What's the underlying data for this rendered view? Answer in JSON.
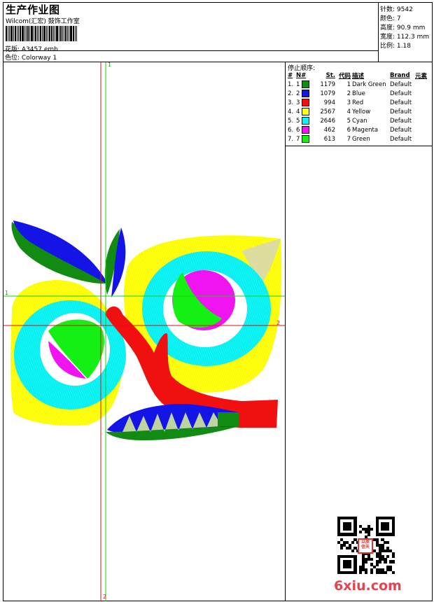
{
  "header": {
    "title": "生产作业图",
    "subtitle": "Wilcom(汇宏) 鼓饰工作室",
    "design_label": "花版:",
    "design_value": "A3457.emb",
    "colorway_label": "色位:",
    "colorway_value": "Colorway 1"
  },
  "stats": [
    {
      "label": "针数:",
      "value": "9542"
    },
    {
      "label": "颜色:",
      "value": "7"
    },
    {
      "label": "高度:",
      "value": "90.9 mm"
    },
    {
      "label": "宽度:",
      "value": "112.3 mm"
    },
    {
      "label": "比例:",
      "value": "1.18"
    }
  ],
  "stop_sequence": {
    "title": "停止顺序:",
    "headers": {
      "seq": "#",
      "n": "N#",
      "st": "St.",
      "code": "代码",
      "desc": "描述",
      "brand": "Brand",
      "elem": "元素"
    },
    "rows": [
      {
        "seq": "1.",
        "n": "1",
        "color": "#118b11",
        "st": "1179",
        "code": "1",
        "desc": "Dark Green",
        "brand": "Default"
      },
      {
        "seq": "2.",
        "n": "2",
        "color": "#1414e6",
        "st": "1079",
        "code": "2",
        "desc": "Blue",
        "brand": "Default"
      },
      {
        "seq": "3.",
        "n": "3",
        "color": "#f01010",
        "st": "994",
        "code": "3",
        "desc": "Red",
        "brand": "Default"
      },
      {
        "seq": "4.",
        "n": "4",
        "color": "#ffff14",
        "st": "2567",
        "code": "4",
        "desc": "Yellow",
        "brand": "Default"
      },
      {
        "seq": "5.",
        "n": "5",
        "color": "#14f0f0",
        "st": "2646",
        "code": "5",
        "desc": "Cyan",
        "brand": "Default"
      },
      {
        "seq": "6.",
        "n": "6",
        "color": "#f014f0",
        "st": "462",
        "code": "6",
        "desc": "Magenta",
        "brand": "Default"
      },
      {
        "seq": "7.",
        "n": "7",
        "color": "#14f014",
        "st": "613",
        "code": "7",
        "desc": "Green",
        "brand": "Default"
      }
    ]
  },
  "guides": {
    "v1": "1",
    "h1": "1",
    "h2": "2",
    "v2": "2"
  },
  "watermark": "6xiu.com",
  "stamp_text": "以质\n信天"
}
